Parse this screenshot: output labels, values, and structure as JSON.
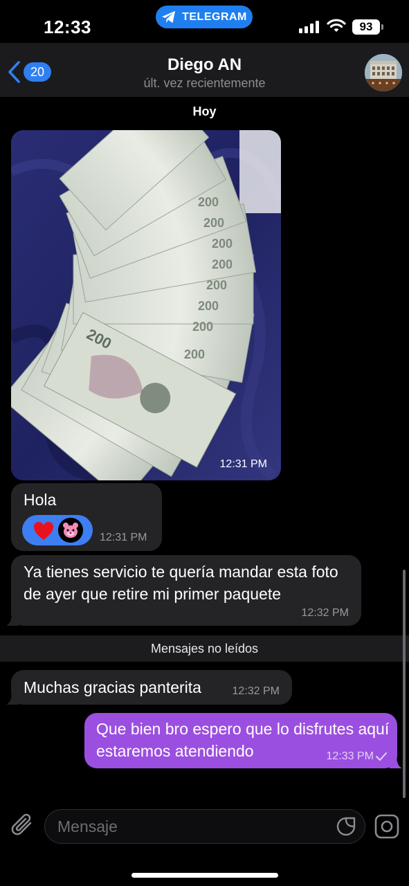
{
  "status_bar": {
    "time": "12:33",
    "app_pill": "TELEGRAM",
    "battery": "93"
  },
  "header": {
    "back_count": "20",
    "contact_name": "Diego AN",
    "contact_status": "últ. vez recientemente"
  },
  "chat": {
    "date_chip": "Hoy",
    "photo_time": "12:31 PM",
    "messages": [
      {
        "text": "Hola",
        "time": "12:31 PM",
        "reactions": [
          "heart-icon",
          "pink-panther-avatar"
        ]
      },
      {
        "text": "Ya tienes servicio te quería mandar esta foto de ayer que retire mi primer paquete",
        "time": "12:32 PM"
      },
      {
        "text": "Muchas gracias panterita",
        "time": "12:32 PM"
      },
      {
        "text": "Que bien bro espero que lo disfrutes aquí estaremos atendiendo",
        "time": "12:33 PM",
        "outgoing": true,
        "status": "sent-check-icon"
      }
    ],
    "unread_divider": "Mensajes no leídos"
  },
  "input": {
    "placeholder": "Mensaje"
  },
  "colors": {
    "accent": "#2f7ff0",
    "outgoing_bubble": "#9b4fe0",
    "incoming_bubble": "#242426",
    "header_bg": "#1b1b1d"
  }
}
